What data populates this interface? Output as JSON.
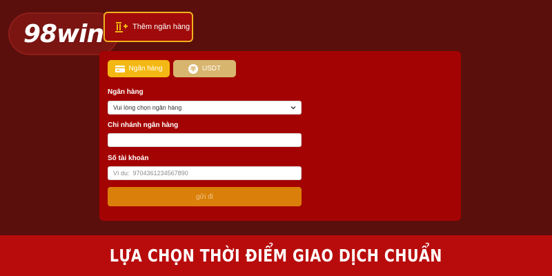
{
  "brand": {
    "logo_text": "98win"
  },
  "header": {
    "add_bank_label": "Thêm ngân hàng",
    "add_bank_icon": "bank-plus-icon"
  },
  "tabs": [
    {
      "label": "Ngân hàng",
      "icon": "card-icon",
      "active": true
    },
    {
      "label": "USDT",
      "icon": "tether-icon",
      "active": false
    }
  ],
  "form": {
    "bank_label": "Ngân hàng",
    "bank_select_value": "Vui lòng chọn ngân hàng",
    "branch_label": "Chi nhánh ngân hàng",
    "branch_value": "",
    "account_label": "Số tài khoản",
    "account_placeholder": "Ví dụ:  9704361234567890",
    "submit_label": "gửi đi"
  },
  "banner": {
    "text": "LỰA CHỌN THỜI ĐIỂM GIAO DỊCH CHUẨN"
  },
  "colors": {
    "background": "#5a0f0c",
    "panel": "#a40303",
    "accent_gold": "#f4b814",
    "submit": "#d97f0a",
    "banner": "#b80c0c"
  }
}
